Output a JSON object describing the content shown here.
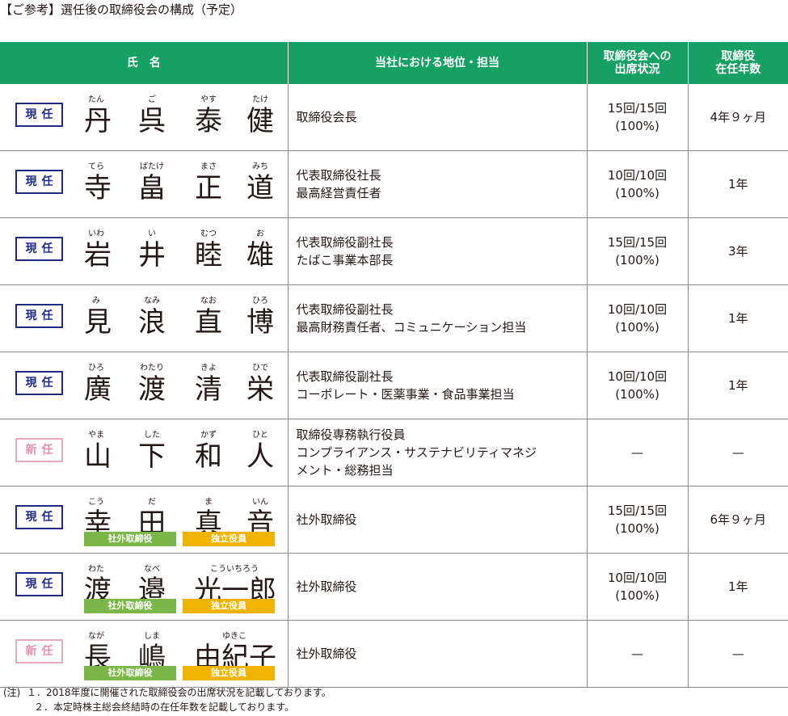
{
  "title": "【ご参考】選任後の取締役会の構成（予定）",
  "table": {
    "headers": {
      "name": "氏　名",
      "position": "当社における地位・担当",
      "attendance_line1": "取締役会への",
      "attendance_line2": "出席状況",
      "tenure_line1": "取締役",
      "tenure_line2": "在任年数"
    },
    "rows": [
      {
        "status": "現任",
        "status_type": "current",
        "chars": [
          "丹",
          "呉",
          "泰",
          "健"
        ],
        "ruby": [
          "たん",
          "ご",
          "やす",
          "たけ"
        ],
        "position_lines": [
          "取締役会長"
        ],
        "attendance_line1": "15回/15回",
        "attendance_line2": "(100%)",
        "tenure": "4年９ヶ月",
        "tags": []
      },
      {
        "status": "現任",
        "status_type": "current",
        "chars": [
          "寺",
          "畠",
          "正",
          "道"
        ],
        "ruby": [
          "てら",
          "ばたけ",
          "まさ",
          "みち"
        ],
        "position_lines": [
          "代表取締役社長",
          "最高経営責任者"
        ],
        "attendance_line1": "10回/10回",
        "attendance_line2": "(100%)",
        "tenure": "1年",
        "tags": []
      },
      {
        "status": "現任",
        "status_type": "current",
        "chars": [
          "岩",
          "井",
          "睦",
          "雄"
        ],
        "ruby": [
          "いわ",
          "い",
          "むつ",
          "お"
        ],
        "position_lines": [
          "代表取締役副社長",
          "たばこ事業本部長"
        ],
        "attendance_line1": "15回/15回",
        "attendance_line2": "(100%)",
        "tenure": "3年",
        "tags": []
      },
      {
        "status": "現任",
        "status_type": "current",
        "chars": [
          "見",
          "浪",
          "直",
          "博"
        ],
        "ruby": [
          "み",
          "なみ",
          "なお",
          "ひろ"
        ],
        "position_lines": [
          "代表取締役副社長",
          "最高財務責任者、コミュニケーション担当"
        ],
        "attendance_line1": "10回/10回",
        "attendance_line2": "(100%)",
        "tenure": "1年",
        "tags": []
      },
      {
        "status": "現任",
        "status_type": "current",
        "chars": [
          "廣",
          "渡",
          "清",
          "栄"
        ],
        "ruby": [
          "ひろ",
          "わたり",
          "きよ",
          "ひで"
        ],
        "position_lines": [
          "代表取締役副社長",
          "コーポレート・医薬事業・食品事業担当"
        ],
        "attendance_line1": "10回/10回",
        "attendance_line2": "(100%)",
        "tenure": "1年",
        "tags": []
      },
      {
        "status": "新任",
        "status_type": "new",
        "chars": [
          "山",
          "下",
          "和",
          "人"
        ],
        "ruby": [
          "やま",
          "した",
          "かず",
          "ひと"
        ],
        "position_lines": [
          "取締役専務執行役員",
          "コンプライアンス・サステナビリティマネジ",
          "メント・総務担当"
        ],
        "attendance_line1": "—",
        "attendance_line2": "",
        "tenure": "—",
        "tags": []
      },
      {
        "status": "現任",
        "status_type": "current",
        "chars": [
          "幸",
          "田",
          "真",
          "音"
        ],
        "ruby": [
          "こう",
          "だ",
          "ま",
          "いん"
        ],
        "position_lines": [
          "社外取締役"
        ],
        "attendance_line1": "15回/15回",
        "attendance_line2": "(100%)",
        "tenure": "6年９ヶ月",
        "tags": [
          "社外取締役",
          "独立役員"
        ]
      },
      {
        "status": "現任",
        "status_type": "current",
        "chars": [
          "渡",
          "邉",
          "光一郎"
        ],
        "ruby": [
          "わた",
          "なべ",
          "こういちろう"
        ],
        "position_lines": [
          "社外取締役"
        ],
        "attendance_line1": "10回/10回",
        "attendance_line2": "(100%)",
        "tenure": "1年",
        "tags": [
          "社外取締役",
          "独立役員"
        ]
      },
      {
        "status": "新任",
        "status_type": "new",
        "chars": [
          "長",
          "嶋",
          "由紀子"
        ],
        "ruby": [
          "なが",
          "しま",
          "ゆきこ"
        ],
        "position_lines": [
          "社外取締役"
        ],
        "attendance_line1": "—",
        "attendance_line2": "",
        "tenure": "—",
        "tags": [
          "社外取締役",
          "独立役員"
        ]
      }
    ]
  },
  "notes": {
    "label": "(注)",
    "items": [
      "１．2018年度に開催された取締役会の出席状況を記載しております。",
      "２．本定時株主総会終結時の在任年数を記載しております。"
    ]
  }
}
